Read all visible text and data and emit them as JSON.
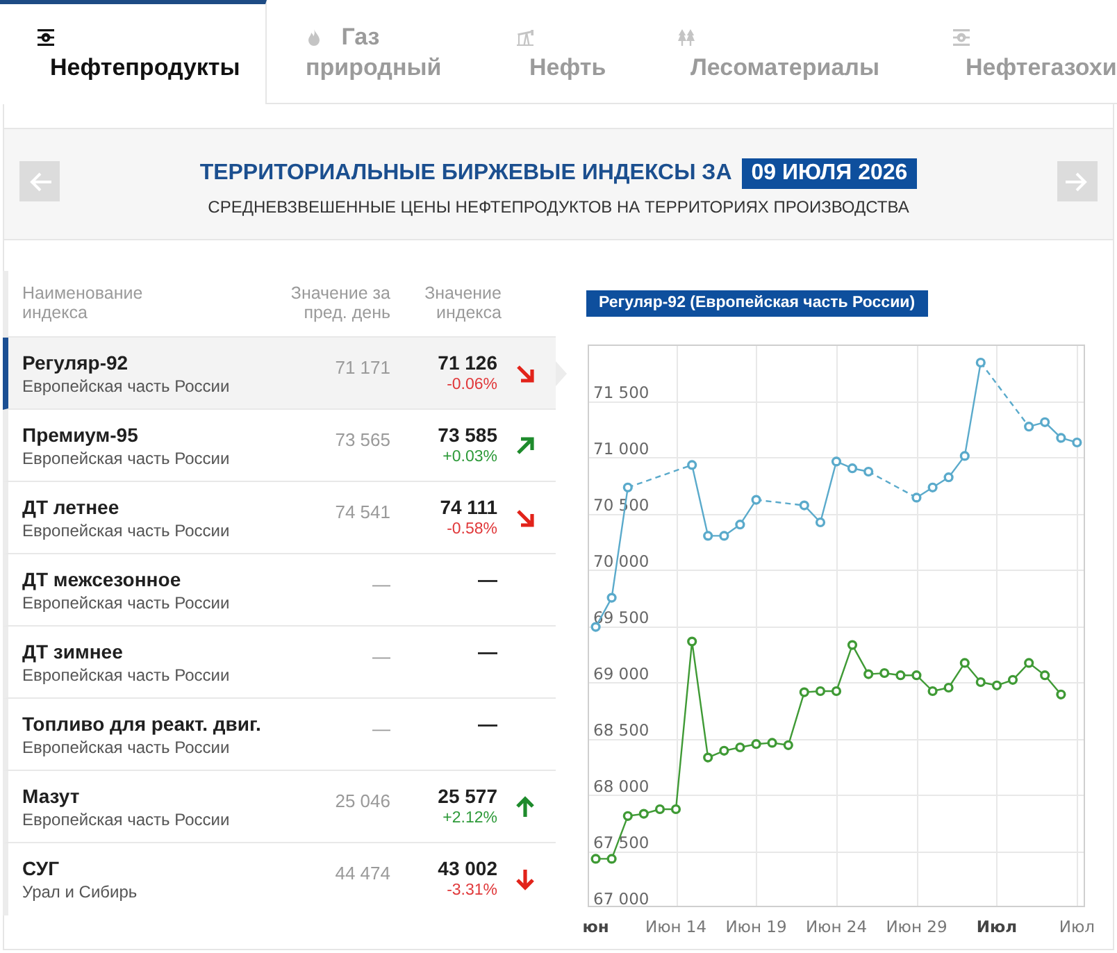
{
  "tabs": [
    {
      "label": "Нефтепродукты",
      "selected": true
    },
    {
      "label": "Газ природный",
      "selected": false
    },
    {
      "label": "Нефть",
      "selected": false
    },
    {
      "label": "Лесоматериалы",
      "selected": false
    },
    {
      "label": "Нефтегазохи",
      "selected": false
    }
  ],
  "header": {
    "title": "ТЕРРИТОРИАЛЬНЫЕ БИРЖЕВЫЕ ИНДЕКСЫ ЗА",
    "date": "09 ИЮЛЯ 2026",
    "subtitle": "СРЕДНЕВЗВЕШЕННЫЕ ЦЕНЫ НЕФТЕПРОДУКТОВ НА ТЕРРИТОРИЯХ ПРОИЗВОДСТВА"
  },
  "table": {
    "columns": [
      "Наименование индекса",
      "Значение за пред. день",
      "Значение индекса"
    ],
    "rows": [
      {
        "kind": "diagonal",
        "name": "Регуляр-92",
        "region": "Европейская часть России",
        "previous": "71 171",
        "value": "71 126",
        "change": "-0.06%",
        "rising": false,
        "selected": true
      },
      {
        "kind": "diagonal",
        "name": "Премиум-95",
        "region": "Европейская часть России",
        "previous": "73 565",
        "value": "73 585",
        "change": "+0.03%",
        "rising": true,
        "selected": false
      },
      {
        "kind": "diagonal",
        "name": "ДТ летнее",
        "region": "Европейская часть России",
        "previous": "74 541",
        "value": "74 111",
        "change": "-0.58%",
        "rising": false,
        "selected": false
      },
      {
        "kind": "plain",
        "name": "ДТ межсезонное",
        "region": "Европейская часть России",
        "previous": "—",
        "value": "—",
        "selected": false
      },
      {
        "kind": "plain",
        "name": "ДТ зимнее",
        "region": "Европейская часть России",
        "previous": "—",
        "value": "—",
        "selected": false
      },
      {
        "kind": "plain",
        "name": "Топливо для реакт. двиг.",
        "region": "Европейская часть России",
        "previous": "—",
        "value": "—",
        "selected": false
      },
      {
        "kind": "vertical",
        "name": "Мазут",
        "region": "Европейская часть России",
        "previous": "25 046",
        "value": "25 577",
        "change": "+2.12%",
        "rising": true,
        "selected": false
      },
      {
        "kind": "vertical",
        "name": "СУГ",
        "region": "Урал и Сибирь",
        "previous": "44 474",
        "value": "43 002",
        "change": "-3.31%",
        "rising": false,
        "selected": false
      }
    ]
  },
  "chart": {
    "axis_label_bold": [
      true,
      false,
      false,
      false,
      false,
      true,
      false
    ],
    "chart_data": {
      "type": "line",
      "title": "Регуляр-92 (Европейская часть России)",
      "grid": true,
      "categories": [
        "юн",
        null,
        null,
        null,
        null,
        "Июн 14",
        null,
        null,
        null,
        null,
        "Июн 19",
        null,
        null,
        null,
        null,
        "Июн 24",
        null,
        null,
        null,
        null,
        "Июн 29",
        null,
        null,
        null,
        null,
        "Июл",
        null,
        null,
        null,
        null,
        "Июл"
      ],
      "series": [
        {
          "color": "#5aaacb",
          "marker": true,
          "values": [
            69490,
            69750,
            70730,
            null,
            null,
            null,
            70930,
            70300,
            70300,
            70400,
            70620,
            null,
            null,
            70570,
            70420,
            70960,
            70900,
            70870,
            null,
            null,
            70640,
            70730,
            70820,
            71010,
            71840,
            null,
            null,
            71270,
            71310,
            71170,
            71130
          ]
        },
        {
          "color": "#3f9a35",
          "marker": true,
          "values": [
            67430,
            67430,
            67810,
            67830,
            67870,
            67870,
            69360,
            68330,
            68390,
            68420,
            68450,
            68460,
            68440,
            68910,
            68920,
            68920,
            69330,
            69070,
            69080,
            69060,
            69060,
            68920,
            68950,
            69170,
            69000,
            68970,
            69020,
            69170,
            69060,
            68890,
            null
          ]
        }
      ],
      "ylim": [
        67000,
        72000
      ],
      "yticks": [
        {
          "value": 67000,
          "label": "67 000"
        },
        {
          "value": 67500,
          "label": "67 500"
        },
        {
          "value": 68000,
          "label": "68 000"
        },
        {
          "value": 68500,
          "label": "68 500"
        },
        {
          "value": 69000,
          "label": "69 000"
        },
        {
          "value": 69500,
          "label": "69 500"
        },
        {
          "value": 70000,
          "label": "70 000"
        },
        {
          "value": 70500,
          "label": "70 500"
        },
        {
          "value": 71000,
          "label": "71 000"
        },
        {
          "value": 71500,
          "label": "71 500"
        }
      ]
    }
  }
}
